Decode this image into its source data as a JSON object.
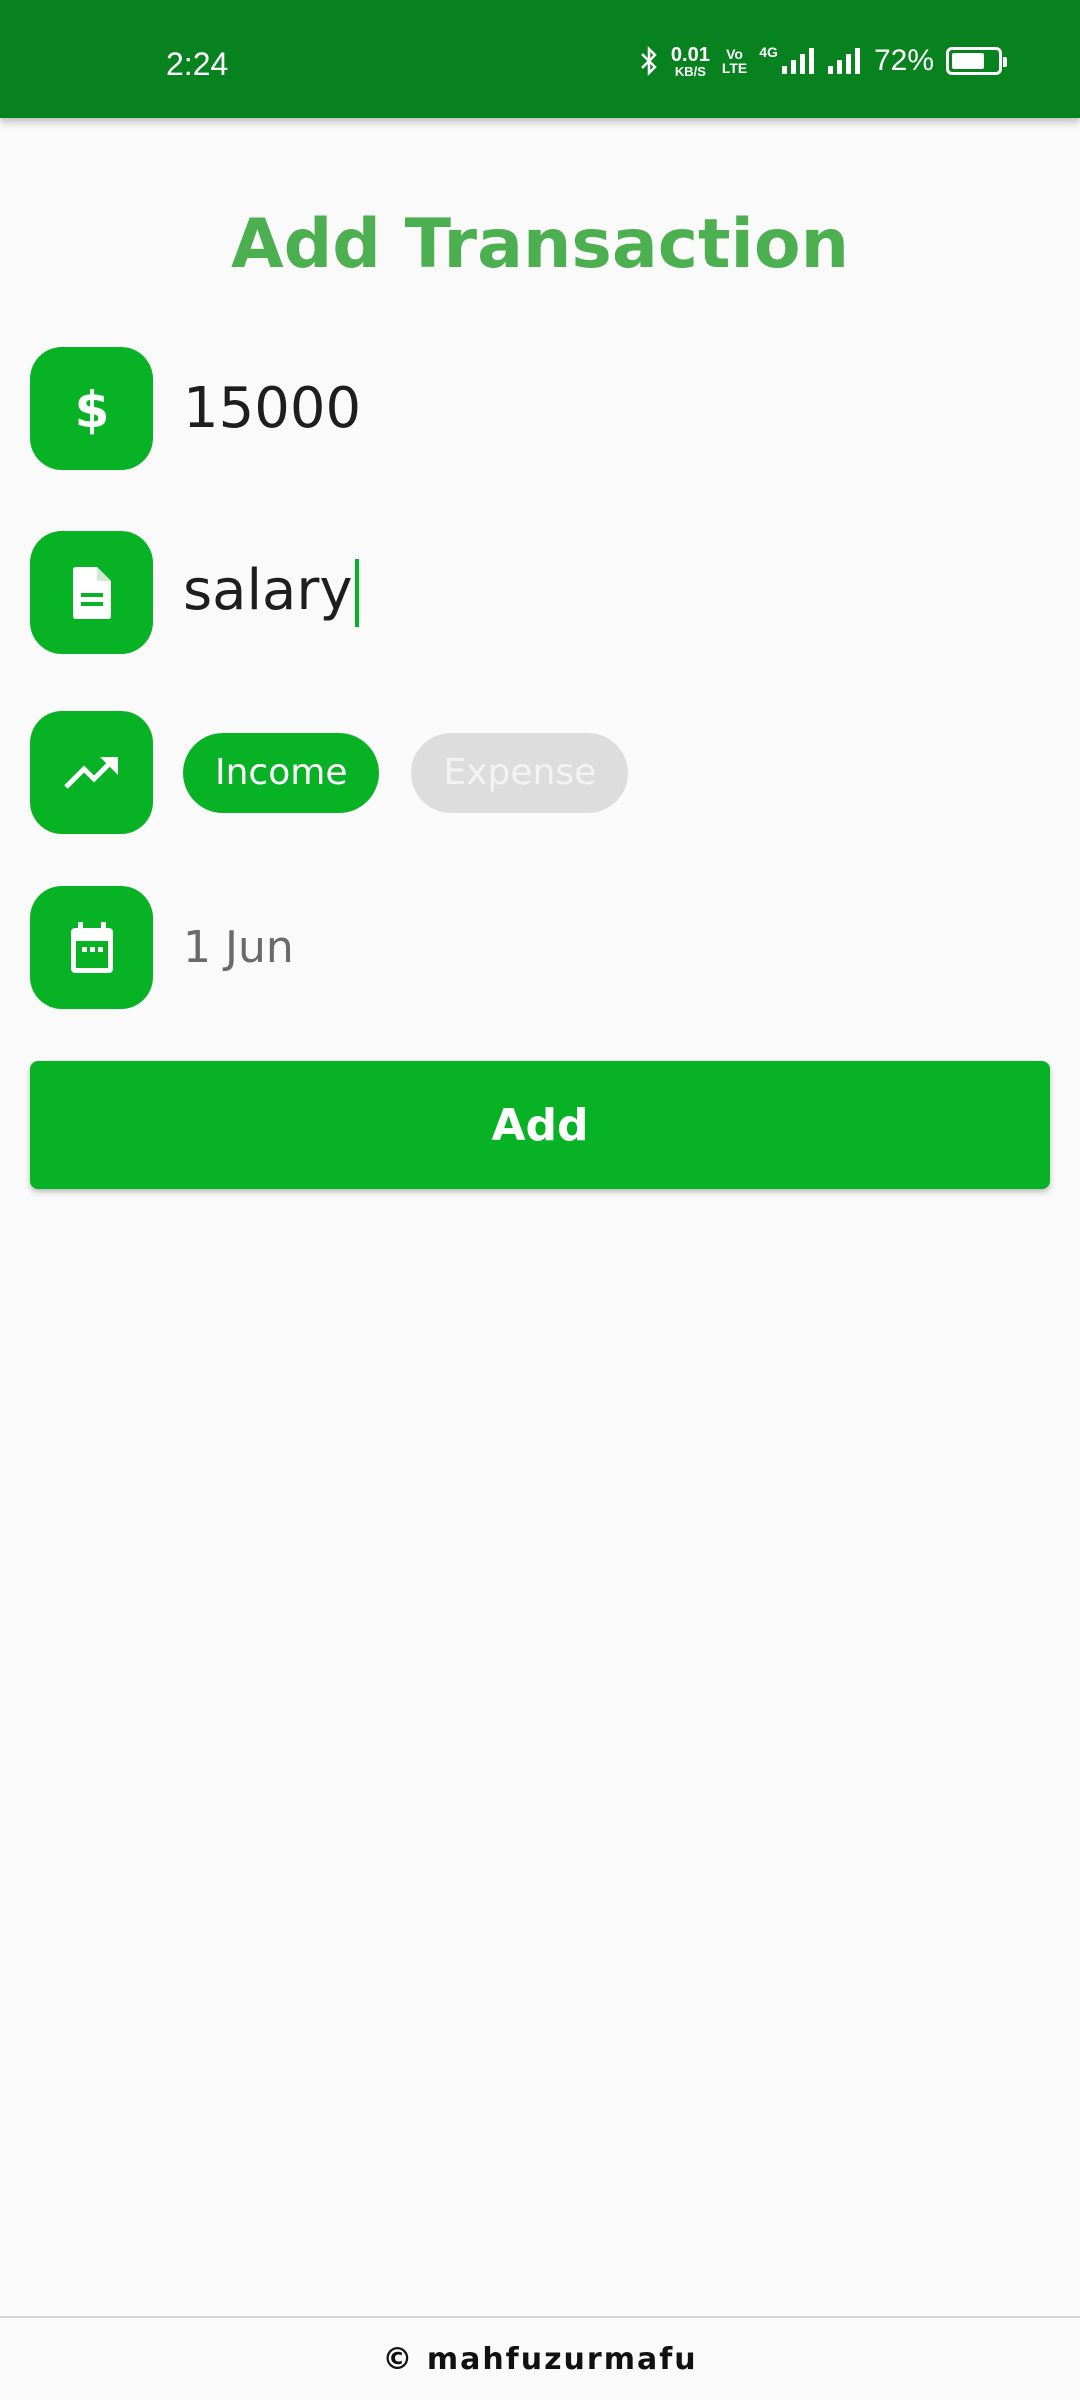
{
  "status_bar": {
    "time": "2:24",
    "net_speed_value": "0.01",
    "net_speed_unit": "KB/S",
    "volte_top": "Vo",
    "volte_bottom": "LTE",
    "network_type": "4G",
    "battery_percent": "72%",
    "battery_level": 0.72,
    "icons": [
      "bluetooth-icon",
      "signal-icon",
      "signal-icon",
      "battery-icon"
    ]
  },
  "page": {
    "title": "Add Transaction"
  },
  "form": {
    "amount": {
      "icon": "dollar-icon",
      "value": "15000"
    },
    "note": {
      "icon": "document-icon",
      "value": "salary"
    },
    "type": {
      "icon": "trending-up-icon",
      "options": [
        "Income",
        "Expense"
      ],
      "selected": "Income"
    },
    "date": {
      "icon": "calendar-icon",
      "value": "1 Jun"
    },
    "submit_label": "Add"
  },
  "footer": {
    "text": "© mahfuzurmafu"
  },
  "colors": {
    "status_bar": "#07821e",
    "accent": "#07b225",
    "title": "#4caf50",
    "chip_inactive": "#dddddd",
    "background": "#fafafa"
  }
}
